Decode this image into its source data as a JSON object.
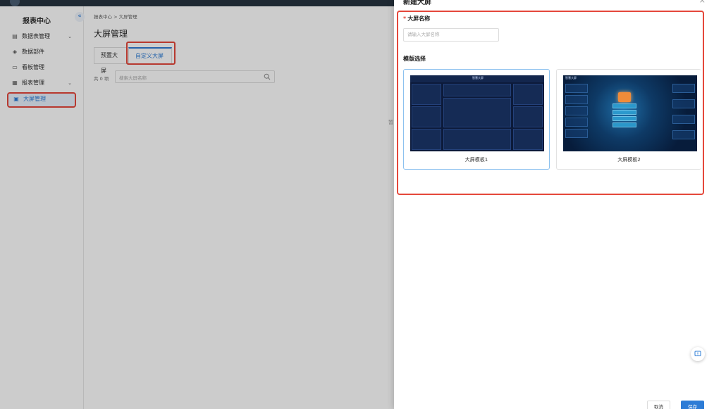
{
  "sidebar": {
    "title": "报表中心",
    "items": [
      {
        "label": "数据表管理",
        "icon": "table-icon",
        "glyph": "▤",
        "has_children": true
      },
      {
        "label": "数据部件",
        "icon": "component-icon",
        "glyph": "◈",
        "has_children": false
      },
      {
        "label": "看板管理",
        "icon": "monitor-icon",
        "glyph": "▭",
        "has_children": false
      },
      {
        "label": "报表管理",
        "icon": "report-icon",
        "glyph": "▦",
        "has_children": true
      },
      {
        "label": "大屏管理",
        "icon": "screen-icon",
        "glyph": "▣",
        "has_children": false,
        "active": true
      }
    ]
  },
  "main": {
    "breadcrumb": "报表中心 > 大屏管理",
    "page_title": "大屏管理",
    "tabs": [
      {
        "label": "预置大屏",
        "active": false
      },
      {
        "label": "自定义大屏",
        "active": true
      }
    ],
    "count_text": "共 0 项",
    "search_placeholder": "搜索大屏名称",
    "empty_hint": "暂"
  },
  "drawer": {
    "title": "新建大屏",
    "name_label": "大屏名称",
    "name_placeholder": "请输入大屏名称",
    "template_label": "模版选择",
    "templates": [
      {
        "name": "大屏模板1",
        "selected": true,
        "preview_title": "智慧大屏"
      },
      {
        "name": "大屏模板2",
        "selected": false,
        "preview_title": "智慧大屏"
      }
    ],
    "cancel_label": "取消",
    "save_label": "保存"
  },
  "colors": {
    "accent": "#2d7cd6",
    "highlight": "#e5483b",
    "topbar": "#1f2933"
  }
}
